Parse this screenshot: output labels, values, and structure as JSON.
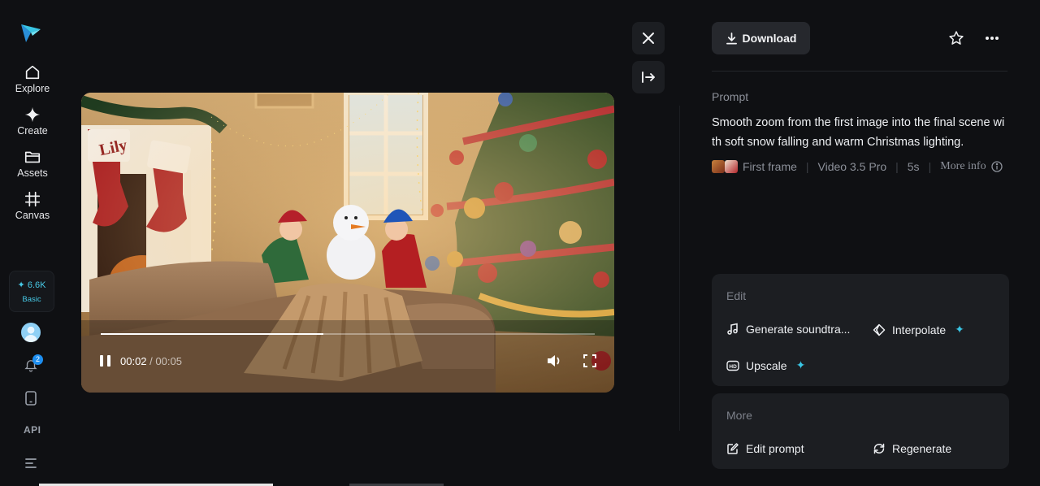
{
  "sidebar": {
    "items": [
      {
        "label": "Explore",
        "icon": "home-icon"
      },
      {
        "label": "Create",
        "icon": "sparkle-icon"
      },
      {
        "label": "Assets",
        "icon": "folder-icon"
      },
      {
        "label": "Canvas",
        "icon": "canvas-icon"
      }
    ],
    "credits": {
      "amount": "✦ 6.6K",
      "plan": "Basic"
    },
    "notifications_count": "2",
    "api_label": "API"
  },
  "player": {
    "current_time": "00:02",
    "duration": "/ 00:05",
    "progress": 0.45,
    "state": "playing"
  },
  "header": {
    "download_label": "Download"
  },
  "details": {
    "prompt_label": "Prompt",
    "prompt_text": "Smooth zoom from the first image into the final scene with soft snow falling and warm Christmas lighting.",
    "first_frame_label": "First frame",
    "model": "Video 3.5 Pro",
    "duration": "5s",
    "more_info": "More info"
  },
  "edit": {
    "title": "Edit",
    "actions": [
      {
        "label": "Generate soundtra...",
        "icon": "music-note-icon",
        "premium": false
      },
      {
        "label": "Interpolate",
        "icon": "interpolate-icon",
        "premium": true
      },
      {
        "label": "Upscale",
        "icon": "hd-icon",
        "premium": true
      }
    ]
  },
  "more": {
    "title": "More",
    "actions": [
      {
        "label": "Edit prompt",
        "icon": "edit-prompt-icon"
      },
      {
        "label": "Regenerate",
        "icon": "regenerate-icon"
      }
    ]
  },
  "colors": {
    "background": "#0f1013",
    "card": "#1c1e22",
    "accent": "#39c5e4",
    "badge": "#1d8ef0"
  }
}
